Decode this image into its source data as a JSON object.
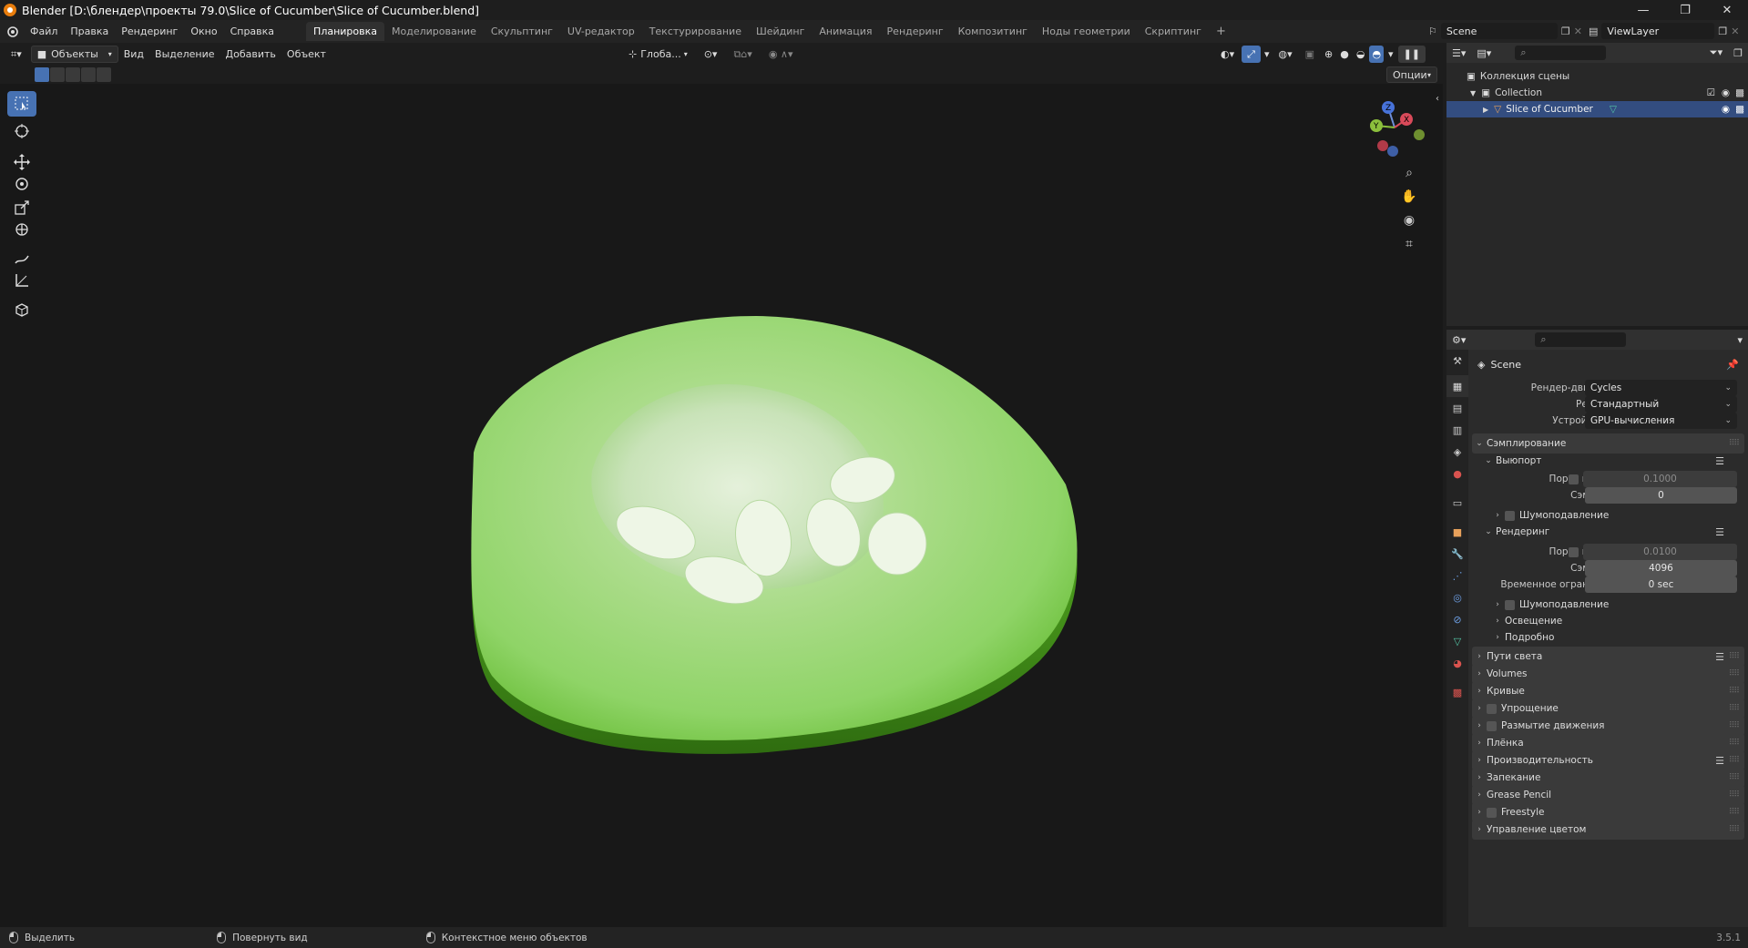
{
  "window": {
    "title": "Blender [D:\\блендер\\проекты 79.0\\Slice of Cucumber\\Slice of Cucumber.blend]",
    "minimize": "—",
    "restore": "❐",
    "close": "✕"
  },
  "menu": [
    "Файл",
    "Правка",
    "Рендеринг",
    "Окно",
    "Справка"
  ],
  "workspaces": [
    "Планировка",
    "Моделирование",
    "Скульптинг",
    "UV-редактор",
    "Текстурирование",
    "Шейдинг",
    "Анимация",
    "Рендеринг",
    "Композитинг",
    "Ноды геометрии",
    "Скриптинг"
  ],
  "scene_field": "Scene",
  "viewlayer_field": "ViewLayer",
  "viewport_header": {
    "mode": "Объекты",
    "menus": [
      "Вид",
      "Выделение",
      "Добавить",
      "Объект"
    ],
    "orientation": "Глоба...",
    "options": "Опции"
  },
  "outliner": {
    "scene_collection": "Коллекция сцены",
    "collection": "Collection",
    "object": "Slice of Cucumber"
  },
  "properties": {
    "context": "Scene",
    "render_engine": {
      "label": "Рендер-движок",
      "value": "Cycles"
    },
    "mode": {
      "label": "Режим",
      "value": "Стандартный"
    },
    "device": {
      "label": "Устройство",
      "value": "GPU-вычисления"
    },
    "sampling": "Сэмплирование",
    "viewport": "Выюпорт",
    "vp_noise": {
      "label": "Порог шума",
      "value": "0.1000"
    },
    "vp_samples": {
      "label": "Сэмплы",
      "value": "0"
    },
    "vp_denoise": "Шумоподавление",
    "render": "Рендеринг",
    "r_noise": {
      "label": "Порог шума",
      "value": "0.0100"
    },
    "r_samples": {
      "label": "Сэмплы",
      "value": "4096"
    },
    "r_time": {
      "label": "Временное огранич...",
      "value": "0 sec"
    },
    "r_denoise": "Шумоподавление",
    "lights": "Освещение",
    "advanced": "Подробно",
    "panels": [
      "Пути света",
      "Volumes",
      "Кривые",
      "Упрощение",
      "Размытие движения",
      "Плёнка",
      "Производительность",
      "Запекание",
      "Grease Pencil",
      "Freestyle",
      "Управление цветом"
    ]
  },
  "status": {
    "select": "Выделить",
    "rotate": "Повернуть вид",
    "context": "Контекстное меню объектов",
    "version": "3.5.1"
  },
  "colors": {
    "accent": "#4772b3",
    "selection": "#334d80",
    "orange": "#e87d0d",
    "cucumber": "#8fd96a"
  }
}
